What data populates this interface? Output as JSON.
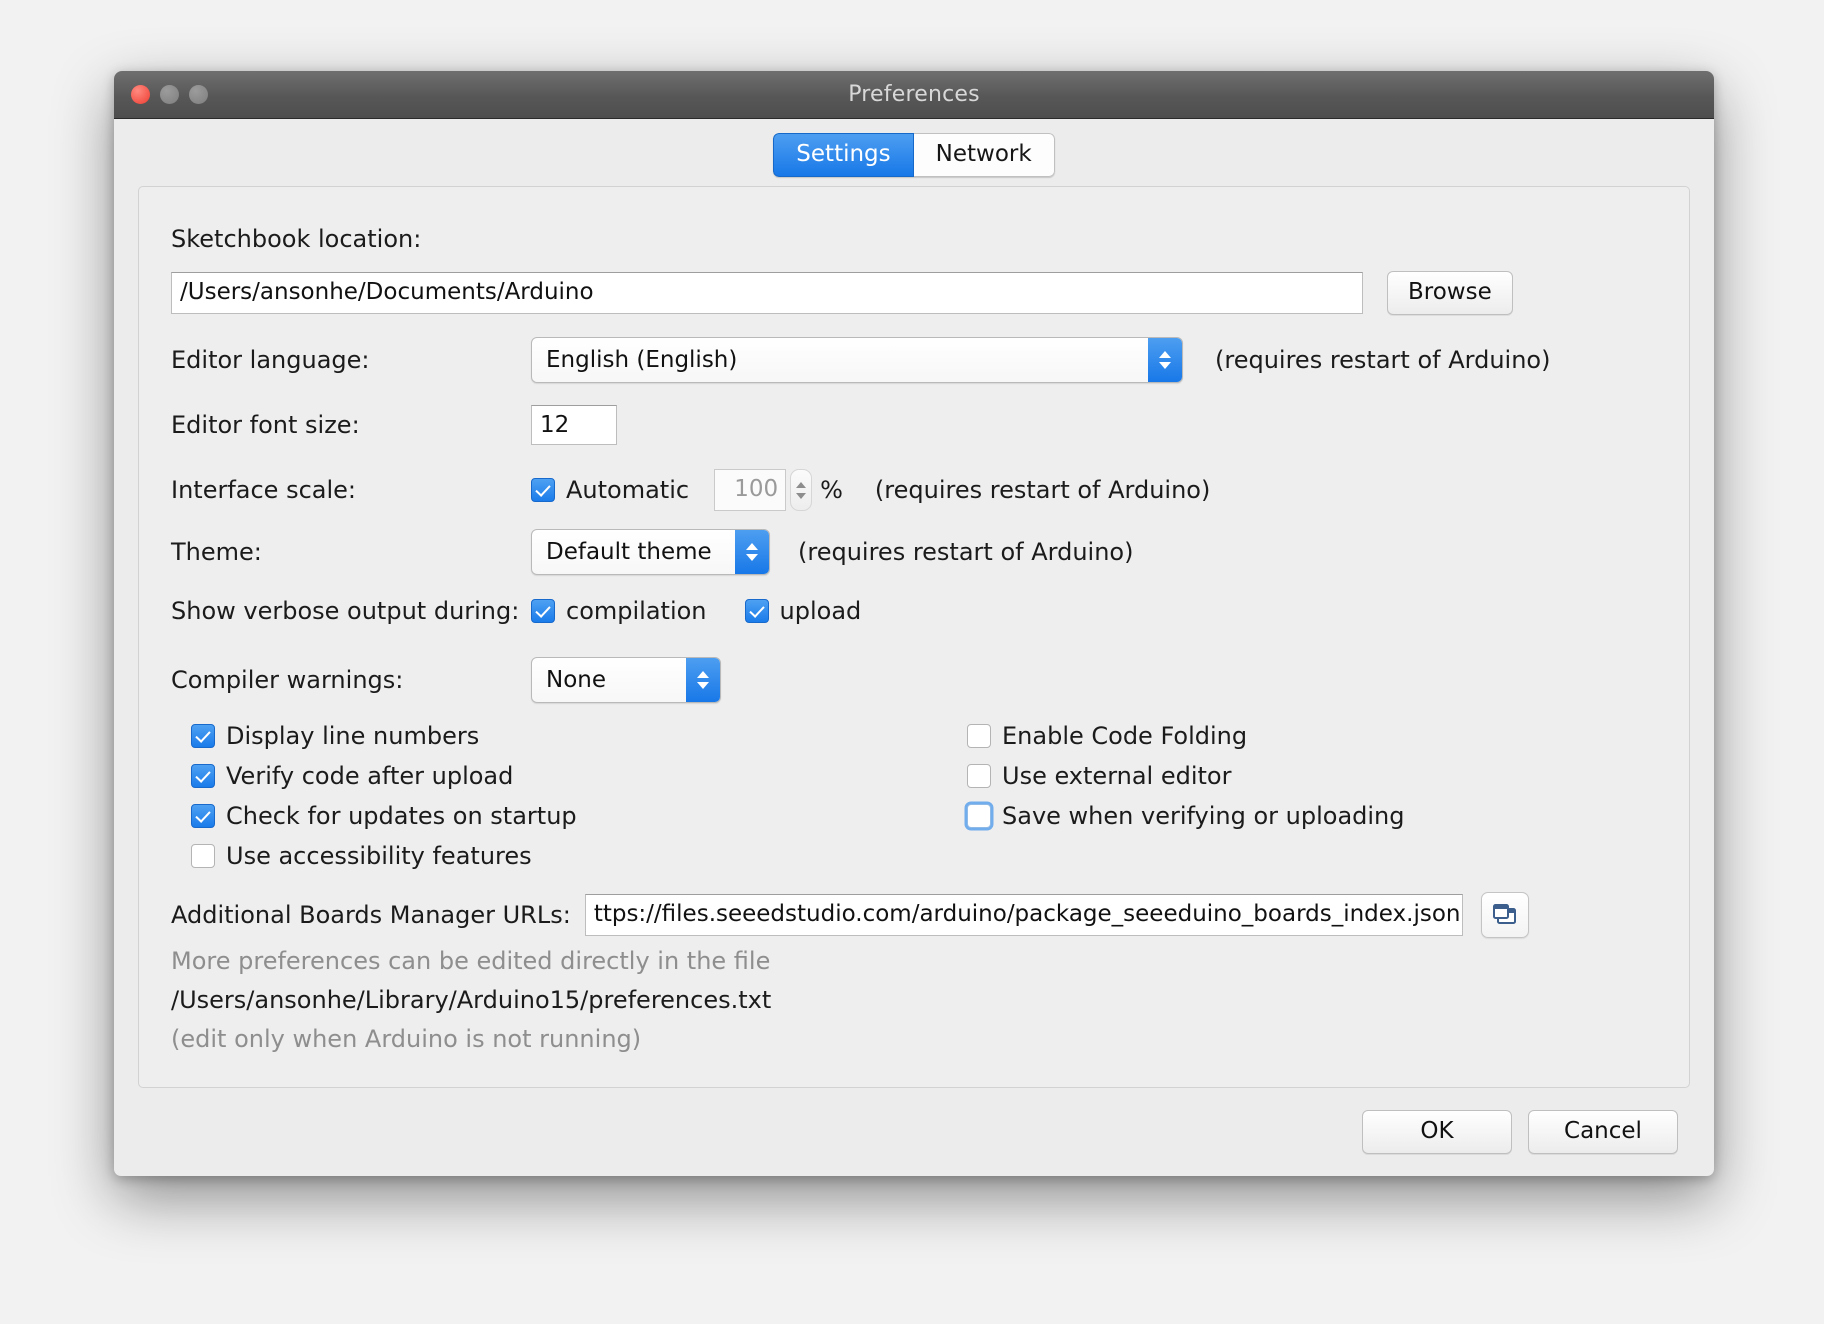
{
  "window": {
    "title": "Preferences",
    "traffic_lights": [
      "close-button",
      "minimize-button",
      "zoom-button"
    ]
  },
  "tabs": [
    {
      "label": "Settings",
      "active": true
    },
    {
      "label": "Network",
      "active": false
    }
  ],
  "settings": {
    "sketchbook": {
      "label": "Sketchbook location:",
      "value": "/Users/ansonhe/Documents/Arduino",
      "browse_label": "Browse"
    },
    "editor_language": {
      "label": "Editor language:",
      "value": "English (English)",
      "note": "(requires restart of Arduino)"
    },
    "editor_font_size": {
      "label": "Editor font size:",
      "value": "12"
    },
    "interface_scale": {
      "label": "Interface scale:",
      "automatic_label": "Automatic",
      "automatic_checked": true,
      "scale_value": "100",
      "percent": "%",
      "note": "(requires restart of Arduino)"
    },
    "theme": {
      "label": "Theme:",
      "value": "Default theme",
      "note": "(requires restart of Arduino)"
    },
    "verbose": {
      "label": "Show verbose output during:",
      "compilation_label": "compilation",
      "compilation_checked": true,
      "upload_label": "upload",
      "upload_checked": true
    },
    "compiler_warnings": {
      "label": "Compiler warnings:",
      "value": "None"
    },
    "checkboxes_left": [
      {
        "label": "Display line numbers",
        "checked": true
      },
      {
        "label": "Verify code after upload",
        "checked": true
      },
      {
        "label": "Check for updates on startup",
        "checked": true
      },
      {
        "label": "Use accessibility features",
        "checked": false
      }
    ],
    "checkboxes_right": [
      {
        "label": "Enable Code Folding",
        "checked": false,
        "focused": false
      },
      {
        "label": "Use external editor",
        "checked": false,
        "focused": false
      },
      {
        "label": "Save when verifying or uploading",
        "checked": false,
        "focused": true
      }
    ],
    "boards_urls": {
      "label": "Additional Boards Manager URLs:",
      "value": "ttps://files.seeedstudio.com/arduino/package_seeeduino_boards_index.json",
      "edit_icon": "cascade-windows-icon"
    },
    "more_prefs": {
      "line1": "More preferences can be edited directly in the file",
      "line2": "/Users/ansonhe/Library/Arduino15/preferences.txt",
      "line3": "(edit only when Arduino is not running)"
    }
  },
  "footer": {
    "ok_label": "OK",
    "cancel_label": "Cancel"
  },
  "colors": {
    "accent_blue": "#1878e8",
    "titlebar": "#575757",
    "panel_bg": "#eeeeee",
    "muted_text": "#8e8e8e"
  }
}
